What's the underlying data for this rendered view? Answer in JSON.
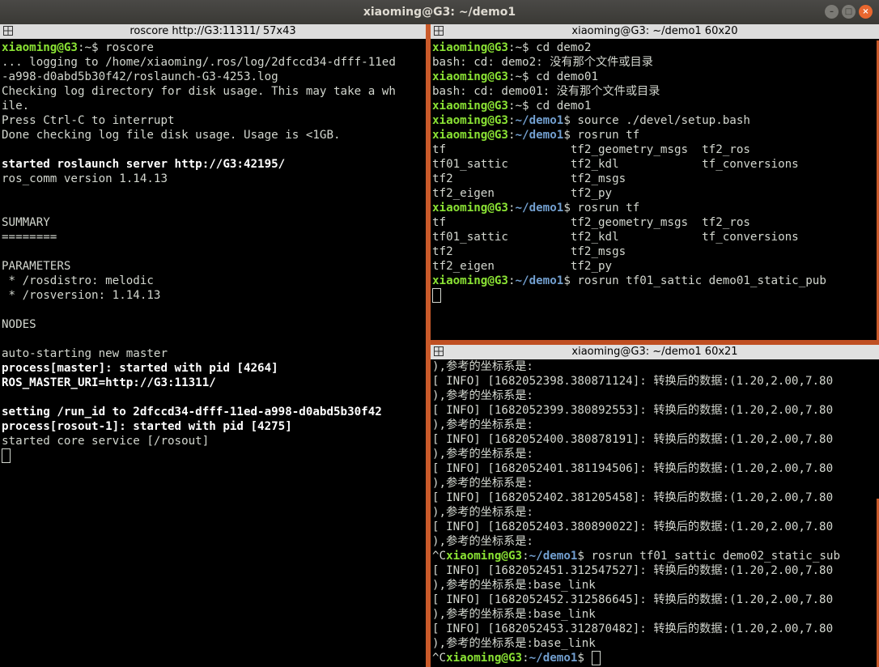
{
  "window": {
    "title": "xiaoming@G3: ~/demo1"
  },
  "panes": {
    "left": {
      "title": "roscore http://G3:11311/ 57x43",
      "lines": [
        [
          {
            "c": "g",
            "t": "xiaoming@G3"
          },
          {
            "c": "n",
            "t": ":~$ roscore"
          }
        ],
        [
          {
            "c": "n",
            "t": "... logging to /home/xiaoming/.ros/log/2dfccd34-dfff-11ed"
          }
        ],
        [
          {
            "c": "n",
            "t": "-a998-d0abd5b30f42/roslaunch-G3-4253.log"
          }
        ],
        [
          {
            "c": "n",
            "t": "Checking log directory for disk usage. This may take a wh"
          }
        ],
        [
          {
            "c": "n",
            "t": "ile."
          }
        ],
        [
          {
            "c": "n",
            "t": "Press Ctrl-C to interrupt"
          }
        ],
        [
          {
            "c": "n",
            "t": "Done checking log file disk usage. Usage is <1GB."
          }
        ],
        [],
        [
          {
            "c": "bold",
            "t": "started roslaunch server http://G3:42195/"
          }
        ],
        [
          {
            "c": "n",
            "t": "ros_comm version 1.14.13"
          }
        ],
        [],
        [],
        [
          {
            "c": "n",
            "t": "SUMMARY"
          }
        ],
        [
          {
            "c": "n",
            "t": "========"
          }
        ],
        [],
        [
          {
            "c": "n",
            "t": "PARAMETERS"
          }
        ],
        [
          {
            "c": "n",
            "t": " * /rosdistro: melodic"
          }
        ],
        [
          {
            "c": "n",
            "t": " * /rosversion: 1.14.13"
          }
        ],
        [],
        [
          {
            "c": "n",
            "t": "NODES"
          }
        ],
        [],
        [
          {
            "c": "n",
            "t": "auto-starting new master"
          }
        ],
        [
          {
            "c": "bold",
            "t": "process[master]: started with pid [4264]"
          }
        ],
        [
          {
            "c": "bold",
            "t": "ROS_MASTER_URI=http://G3:11311/"
          }
        ],
        [],
        [
          {
            "c": "bold",
            "t": "setting /run_id to 2dfccd34-dfff-11ed-a998-d0abd5b30f42"
          }
        ],
        [
          {
            "c": "bold",
            "t": "process[rosout-1]: started with pid [4275]"
          }
        ],
        [
          {
            "c": "n",
            "t": "started core service [/rosout]"
          }
        ],
        [
          {
            "c": "cursor",
            "t": ""
          }
        ]
      ]
    },
    "top_right": {
      "title": "xiaoming@G3: ~/demo1 60x20",
      "lines": [
        [
          {
            "c": "g",
            "t": "xiaoming@G3"
          },
          {
            "c": "n",
            "t": ":~$ cd demo2"
          }
        ],
        [
          {
            "c": "n",
            "t": "bash: cd: demo2: 没有那个文件或目录"
          }
        ],
        [
          {
            "c": "g",
            "t": "xiaoming@G3"
          },
          {
            "c": "n",
            "t": ":~$ cd demo01"
          }
        ],
        [
          {
            "c": "n",
            "t": "bash: cd: demo01: 没有那个文件或目录"
          }
        ],
        [
          {
            "c": "g",
            "t": "xiaoming@G3"
          },
          {
            "c": "n",
            "t": ":~$ cd demo1"
          }
        ],
        [
          {
            "c": "g",
            "t": "xiaoming@G3"
          },
          {
            "c": "n",
            "t": ":"
          },
          {
            "c": "b",
            "t": "~/demo1"
          },
          {
            "c": "n",
            "t": "$ source ./devel/setup.bash"
          }
        ],
        [
          {
            "c": "g",
            "t": "xiaoming@G3"
          },
          {
            "c": "n",
            "t": ":"
          },
          {
            "c": "b",
            "t": "~/demo1"
          },
          {
            "c": "n",
            "t": "$ rosrun tf"
          }
        ],
        [
          {
            "c": "n",
            "t": "tf                  tf2_geometry_msgs  tf2_ros"
          }
        ],
        [
          {
            "c": "n",
            "t": "tf01_sattic         tf2_kdl            tf_conversions"
          }
        ],
        [
          {
            "c": "n",
            "t": "tf2                 tf2_msgs"
          }
        ],
        [
          {
            "c": "n",
            "t": "tf2_eigen           tf2_py"
          }
        ],
        [
          {
            "c": "g",
            "t": "xiaoming@G3"
          },
          {
            "c": "n",
            "t": ":"
          },
          {
            "c": "b",
            "t": "~/demo1"
          },
          {
            "c": "n",
            "t": "$ rosrun tf"
          }
        ],
        [
          {
            "c": "n",
            "t": "tf                  tf2_geometry_msgs  tf2_ros"
          }
        ],
        [
          {
            "c": "n",
            "t": "tf01_sattic         tf2_kdl            tf_conversions"
          }
        ],
        [
          {
            "c": "n",
            "t": "tf2                 tf2_msgs"
          }
        ],
        [
          {
            "c": "n",
            "t": "tf2_eigen           tf2_py"
          }
        ],
        [
          {
            "c": "g",
            "t": "xiaoming@G3"
          },
          {
            "c": "n",
            "t": ":"
          },
          {
            "c": "b",
            "t": "~/demo1"
          },
          {
            "c": "n",
            "t": "$ rosrun tf01_sattic demo01_static_pub"
          }
        ],
        [
          {
            "c": "cursor",
            "t": ""
          }
        ]
      ]
    },
    "bottom_right": {
      "title": "xiaoming@G3: ~/demo1 60x21",
      "lines": [
        [
          {
            "c": "n",
            "t": "),参考的坐标系是:"
          }
        ],
        [
          {
            "c": "n",
            "t": "[ INFO] [1682052398.380871124]: 转换后的数据:(1.20,2.00,7.80"
          }
        ],
        [
          {
            "c": "n",
            "t": "),参考的坐标系是:"
          }
        ],
        [
          {
            "c": "n",
            "t": "[ INFO] [1682052399.380892553]: 转换后的数据:(1.20,2.00,7.80"
          }
        ],
        [
          {
            "c": "n",
            "t": "),参考的坐标系是:"
          }
        ],
        [
          {
            "c": "n",
            "t": "[ INFO] [1682052400.380878191]: 转换后的数据:(1.20,2.00,7.80"
          }
        ],
        [
          {
            "c": "n",
            "t": "),参考的坐标系是:"
          }
        ],
        [
          {
            "c": "n",
            "t": "[ INFO] [1682052401.381194506]: 转换后的数据:(1.20,2.00,7.80"
          }
        ],
        [
          {
            "c": "n",
            "t": "),参考的坐标系是:"
          }
        ],
        [
          {
            "c": "n",
            "t": "[ INFO] [1682052402.381205458]: 转换后的数据:(1.20,2.00,7.80"
          }
        ],
        [
          {
            "c": "n",
            "t": "),参考的坐标系是:"
          }
        ],
        [
          {
            "c": "n",
            "t": "[ INFO] [1682052403.380890022]: 转换后的数据:(1.20,2.00,7.80"
          }
        ],
        [
          {
            "c": "n",
            "t": "),参考的坐标系是:"
          }
        ],
        [
          {
            "c": "n",
            "t": "^C"
          },
          {
            "c": "g",
            "t": "xiaoming@G3"
          },
          {
            "c": "n",
            "t": ":"
          },
          {
            "c": "b",
            "t": "~/demo1"
          },
          {
            "c": "n",
            "t": "$ rosrun tf01_sattic demo02_static_sub"
          }
        ],
        [
          {
            "c": "n",
            "t": "[ INFO] [1682052451.312547527]: 转换后的数据:(1.20,2.00,7.80"
          }
        ],
        [
          {
            "c": "n",
            "t": "),参考的坐标系是:base_link"
          }
        ],
        [
          {
            "c": "n",
            "t": "[ INFO] [1682052452.312586645]: 转换后的数据:(1.20,2.00,7.80"
          }
        ],
        [
          {
            "c": "n",
            "t": "),参考的坐标系是:base_link"
          }
        ],
        [
          {
            "c": "n",
            "t": "[ INFO] [1682052453.312870482]: 转换后的数据:(1.20,2.00,7.80"
          }
        ],
        [
          {
            "c": "n",
            "t": "),参考的坐标系是:base_link"
          }
        ],
        [
          {
            "c": "n",
            "t": "^C"
          },
          {
            "c": "g",
            "t": "xiaoming@G3"
          },
          {
            "c": "n",
            "t": ":"
          },
          {
            "c": "b",
            "t": "~/demo1"
          },
          {
            "c": "n",
            "t": "$ "
          },
          {
            "c": "cursor",
            "t": ""
          }
        ]
      ]
    }
  }
}
